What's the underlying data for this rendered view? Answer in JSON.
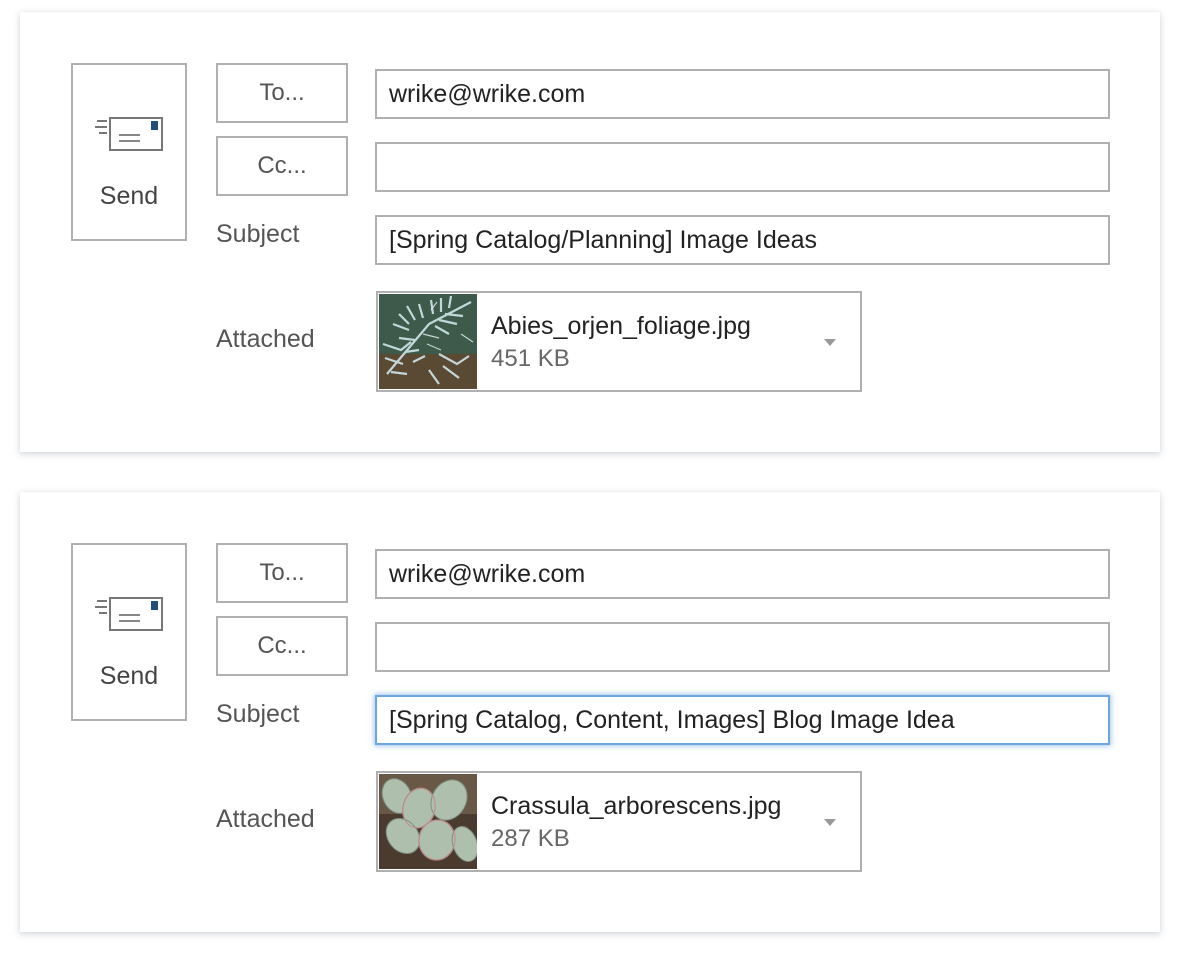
{
  "compose_windows": [
    {
      "send_label": "Send",
      "to_button": "To...",
      "cc_button": "Cc...",
      "to_value": "wrike@wrike.com",
      "cc_value": "",
      "subject_label": "Subject",
      "subject_value": "[Spring Catalog/Planning] Image Ideas",
      "attached_label": "Attached",
      "attachment": {
        "name": "Abies_orjen_foliage.jpg",
        "size": "451 KB"
      }
    },
    {
      "send_label": "Send",
      "to_button": "To...",
      "cc_button": "Cc...",
      "to_value": "wrike@wrike.com",
      "cc_value": "",
      "subject_label": "Subject",
      "subject_value": "[Spring Catalog, Content, Images] Blog Image Idea",
      "subject_focused": true,
      "attached_label": "Attached",
      "attachment": {
        "name": "Crassula_arborescens.jpg",
        "size": "287 KB"
      }
    }
  ],
  "colors": {
    "border": "#b0b0b0",
    "focus_border": "#6aa6e0",
    "envelope_stamp": "#1f4e79"
  },
  "icons": [
    "send-envelope-icon",
    "dropdown-caret-icon"
  ]
}
